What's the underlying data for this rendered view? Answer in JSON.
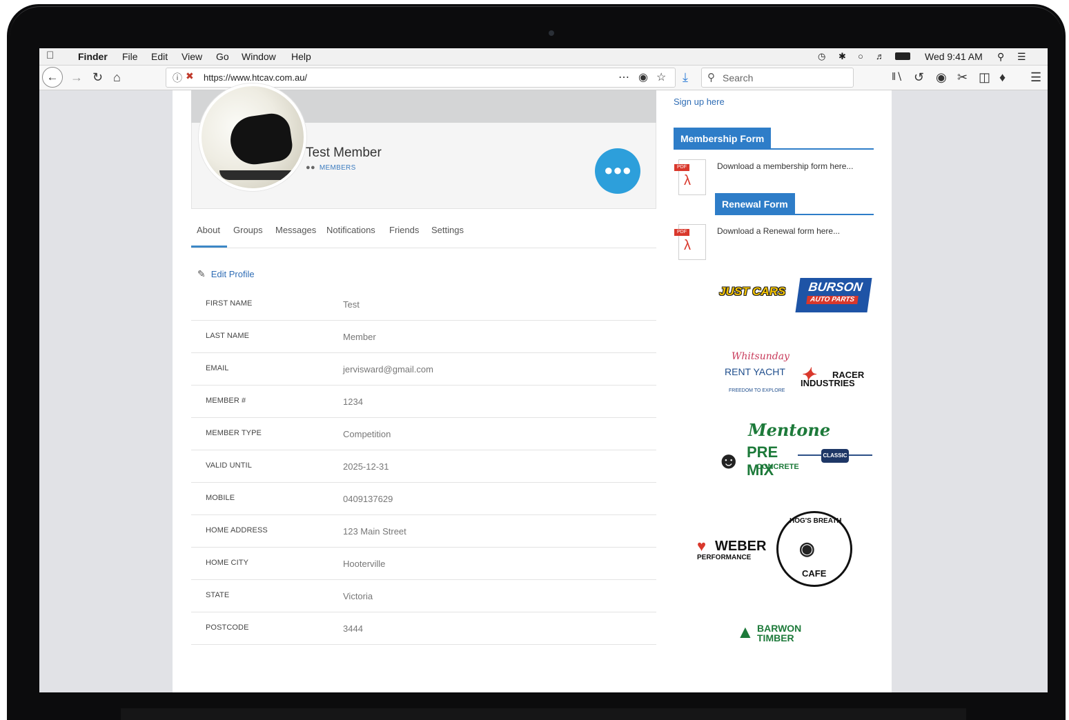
{
  "menubar": {
    "apple_icon": "apple-logo",
    "items": [
      "Finder",
      "File",
      "Edit",
      "View",
      "Go",
      "Window",
      "Help"
    ],
    "clock": "Wed 9:41 AM"
  },
  "browser": {
    "url": "https://www.htcav.com.au/",
    "search_placeholder": "Search"
  },
  "profile": {
    "name": "Test Member",
    "group": "MEMBERS"
  },
  "tabs": [
    "About",
    "Groups",
    "Messages",
    "Notifications",
    "Friends",
    "Settings"
  ],
  "edit_profile": "Edit Profile",
  "fields": [
    {
      "label": "FIRST NAME",
      "value": "Test"
    },
    {
      "label": "LAST NAME",
      "value": "Member"
    },
    {
      "label": "EMAIL",
      "value": "jervisward@gmail.com"
    },
    {
      "label": "MEMBER #",
      "value": "1234"
    },
    {
      "label": "MEMBER TYPE",
      "value": "Competition"
    },
    {
      "label": "VALID UNTIL",
      "value": "2025-12-31"
    },
    {
      "label": "MOBILE",
      "value": "0409137629"
    },
    {
      "label": "HOME ADDRESS",
      "value": "123 Main Street"
    },
    {
      "label": "HOME CITY",
      "value": "Hooterville"
    },
    {
      "label": "STATE",
      "value": "Victoria"
    },
    {
      "label": "POSTCODE",
      "value": "3444"
    }
  ],
  "sidebar": {
    "signup": "Sign up here",
    "membership_title": "Membership Form",
    "membership_text": "Download a membership form here...",
    "renewal_title": "Renewal Form",
    "renewal_text": "Download a Renewal form here...",
    "pdf_label": "PDF",
    "sponsors": {
      "justcars": "JUST CARS",
      "burson": "BURSON",
      "burson_sub": "AUTO PARTS",
      "whitsunday": "Whitsunday",
      "rentyacht": "RENT YACHT",
      "rentyacht_sub": "FREEDOM TO EXPLORE",
      "racer": "RACER",
      "racer_sub": "INDUSTRIES",
      "mentone": "Mentone",
      "premix": "PRE MIX",
      "concrete": "CONCRETE",
      "classic": "CLASSIC",
      "weber": "WEBER",
      "weber_sub": "PERFORMANCE",
      "hogs": "HOG'S BREATH",
      "cafe": "CAFE",
      "barwon": "BARWON",
      "timber": "TIMBER"
    }
  }
}
